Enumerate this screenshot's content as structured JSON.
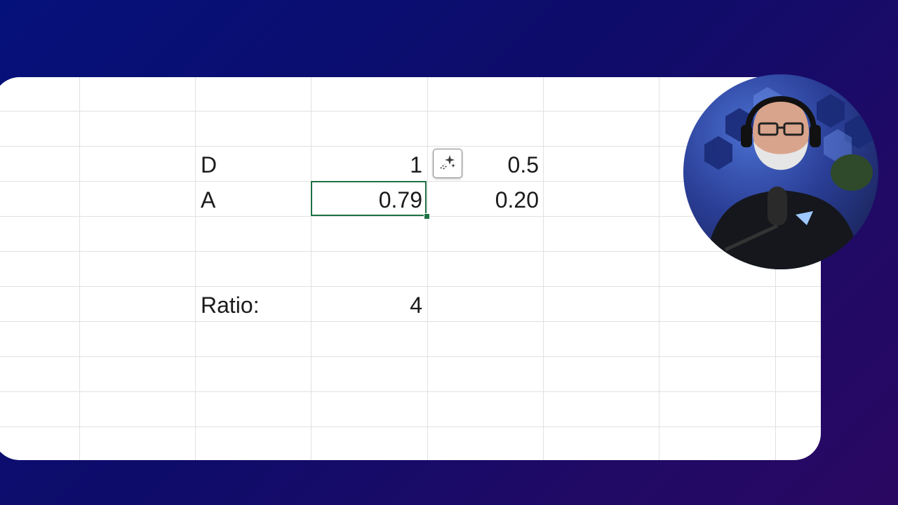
{
  "spreadsheet": {
    "rows": [
      {
        "label": "D",
        "value": "1",
        "value2": "0.5"
      },
      {
        "label": "A",
        "value": "0.79",
        "value2": "0.20"
      },
      {
        "label": "Ratio:",
        "value": "4"
      }
    ],
    "selected_cell_value": "0.79",
    "selection_color": "#1e7145",
    "quick_analysis_icon": "sparkle-icon"
  },
  "background": {
    "gradient_start": "#05117a",
    "gradient_end": "#2a0862"
  },
  "webcam": {
    "description_icon": "presenter-webcam"
  }
}
